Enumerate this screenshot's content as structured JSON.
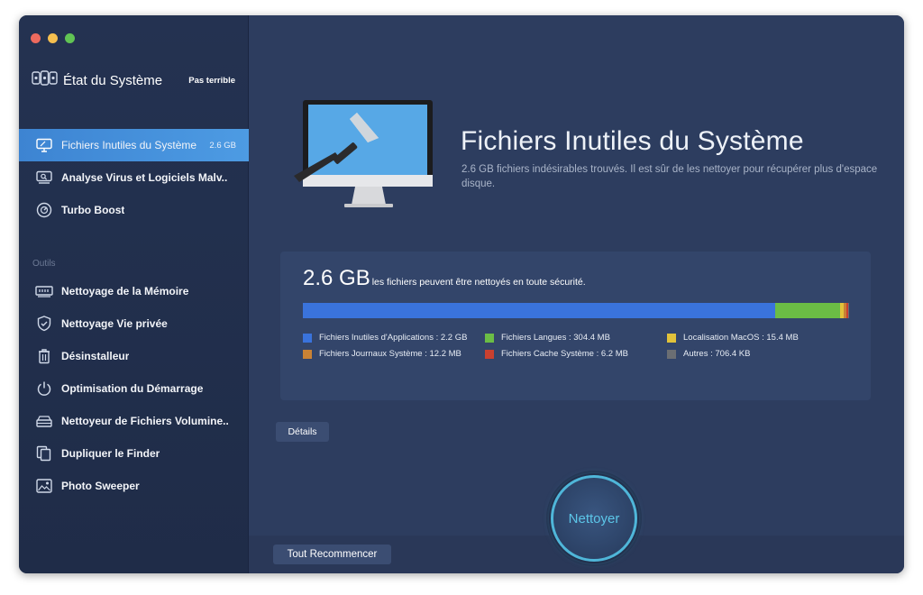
{
  "window": {
    "app_title": "État du Système",
    "status": "Pas terrible"
  },
  "sidebar": {
    "items": [
      {
        "label": "Fichiers Inutiles du Système",
        "meta": "2.6 GB",
        "icon": "monitor-icon"
      },
      {
        "label": "Analyse Virus et Logiciels Malv...",
        "icon": "virus-scan-icon"
      },
      {
        "label": "Turbo Boost",
        "icon": "gauge-icon"
      }
    ],
    "section_label": "Outils",
    "tools": [
      {
        "label": "Nettoyage de la Mémoire",
        "icon": "memory-icon"
      },
      {
        "label": "Nettoyage Vie privée",
        "icon": "shield-icon"
      },
      {
        "label": "Désinstalleur",
        "icon": "trash-icon"
      },
      {
        "label": "Optimisation du Démarrage",
        "icon": "power-icon"
      },
      {
        "label": "Nettoyeur de Fichiers Volumine...",
        "icon": "stack-icon"
      },
      {
        "label": "Dupliquer le Finder",
        "icon": "duplicate-icon"
      },
      {
        "label": "Photo Sweeper",
        "icon": "photo-icon"
      }
    ]
  },
  "main": {
    "title": "Fichiers Inutiles du Système",
    "description": "2.6 GB fichiers indésirables trouvés.  Il est sûr de les nettoyer pour récupérer plus d'espace disque.",
    "summary": {
      "size": "2.6 GB",
      "text": "les fichiers peuvent être nettoyés en toute sécurité."
    },
    "breakdown": [
      {
        "label": "Fichiers Inutiles d'Applications : 2.2 GB",
        "value_mb": 2200,
        "color": "#3a73dc"
      },
      {
        "label": "Fichiers Langues : 304.4 MB",
        "value_mb": 304.4,
        "color": "#6bbd45"
      },
      {
        "label": "Localisation MacOS : 15.4 MB",
        "value_mb": 15.4,
        "color": "#e2c23a"
      },
      {
        "label": "Fichiers Journaux Système : 12.2 MB",
        "value_mb": 12.2,
        "color": "#c98235"
      },
      {
        "label": "Fichiers Cache Système : 6.2 MB",
        "value_mb": 6.2,
        "color": "#c9402f"
      },
      {
        "label": "Autres : 706.4 KB",
        "value_mb": 0.7,
        "color": "#6b6e73"
      }
    ],
    "details_label": "Détails",
    "restart_label": "Tout Recommencer",
    "clean_label": "Nettoyer"
  }
}
